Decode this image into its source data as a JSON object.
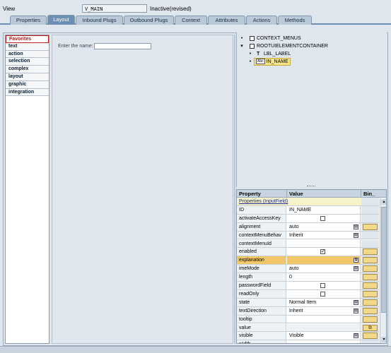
{
  "header": {
    "view_label": "View",
    "view_name": "V_MAIN",
    "view_status": "Inactive(revised)"
  },
  "tabs": [
    {
      "label": "Properties",
      "active": false
    },
    {
      "label": "Layout",
      "active": true
    },
    {
      "label": "Inbound Plugs",
      "active": false
    },
    {
      "label": "Outbound Plugs",
      "active": false
    },
    {
      "label": "Context",
      "active": false
    },
    {
      "label": "Attributes",
      "active": false
    },
    {
      "label": "Actions",
      "active": false
    },
    {
      "label": "Methods",
      "active": false
    }
  ],
  "palette": {
    "items": [
      "Favorites",
      "text",
      "action",
      "selection",
      "complex",
      "layout",
      "graphic",
      "integration"
    ],
    "selected": "Favorites"
  },
  "canvas": {
    "enter_label": "Enter the name:",
    "input_value": ""
  },
  "tree": {
    "nodes": [
      {
        "label": "CONTEXT_MENUS",
        "icon": "checkbox-icon"
      },
      {
        "label": "ROOTUIELEMENTCONTAINER",
        "icon": "checkbox-icon"
      },
      {
        "label": "LBL_LABEL",
        "icon": "label-t-icon",
        "icon_text": "T"
      },
      {
        "label": "IN_NAME",
        "icon": "input-field-icon",
        "icon_text": "Abc",
        "selected": true
      }
    ]
  },
  "properties": {
    "headers": {
      "property": "Property",
      "value": "Value",
      "binding": "Bin_"
    },
    "group_label": "Properties (InputField)",
    "rows": [
      {
        "name": "ID",
        "value": ""
      },
      {
        "name": "activateAccessKey",
        "value": ""
      },
      {
        "name": "alignment",
        "value": "auto"
      },
      {
        "name": "contextMenuBehav",
        "value": "Inherit"
      },
      {
        "name": "contextMenuId",
        "value": ""
      },
      {
        "name": "enabled",
        "value": ""
      },
      {
        "name": "explanation",
        "value": ""
      },
      {
        "name": "imeMode",
        "value": "auto"
      },
      {
        "name": "length",
        "value": "0"
      },
      {
        "name": "passwordField",
        "value": ""
      },
      {
        "name": "readOnly",
        "value": ""
      },
      {
        "name": "state",
        "value": "Normal Item"
      },
      {
        "name": "textDirection",
        "value": "Inherit"
      },
      {
        "name": "tooltip",
        "value": ""
      },
      {
        "name": "value",
        "value": ""
      },
      {
        "name": "visible",
        "value": "Visible"
      },
      {
        "name": "width",
        "value": ""
      }
    ],
    "id_value": "IN_NAME",
    "checked": {
      "activateAccessKey": false,
      "enabled": true,
      "passwordField": false,
      "readOnly": false
    }
  }
}
